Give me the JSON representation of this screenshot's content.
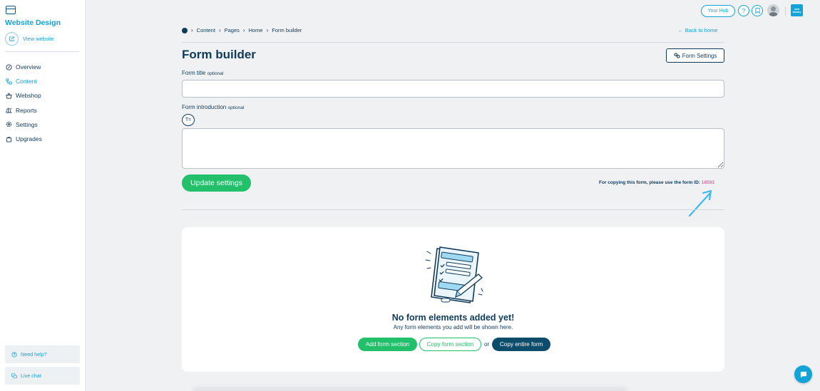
{
  "sidebar": {
    "title": "Website Design",
    "view_website": "View website",
    "items": [
      {
        "label": "Overview",
        "icon": "overview-icon"
      },
      {
        "label": "Content",
        "icon": "content-icon",
        "active": true
      },
      {
        "label": "Webshop",
        "icon": "webshop-icon"
      },
      {
        "label": "Reports",
        "icon": "reports-icon"
      },
      {
        "label": "Settings",
        "icon": "settings-icon"
      },
      {
        "label": "Upgrades",
        "icon": "upgrades-icon"
      }
    ],
    "need_help": "Need help?",
    "live_chat": "Live chat"
  },
  "header": {
    "your_hub": "Your Hub",
    "help_glyph": "?",
    "brand_logo_text": "web factory"
  },
  "breadcrumb": [
    "Content",
    "Pages",
    "Home",
    "Form builder"
  ],
  "back_link": "← Back to home",
  "page_title": "Form builder",
  "form_settings_label": "Form Settings",
  "form_title": {
    "label": "Form title",
    "optional": "optional",
    "value": ""
  },
  "form_intro": {
    "label": "Form introduction",
    "optional": "optional",
    "value": "",
    "format_glyph": "T="
  },
  "update_settings_label": "Update settings",
  "copy_note": {
    "text": "For copying this form, please use the form ID:",
    "form_id": "18593"
  },
  "empty_state": {
    "title": "No form elements added yet!",
    "subtitle": "Any form elements you add will be shown here.",
    "add_section": "Add form section",
    "copy_section": "Copy form section",
    "or": "or",
    "copy_entire": "Copy entire form"
  },
  "colors": {
    "accent": "#12a3d9",
    "navy": "#0e3b5c",
    "green": "#22c06a",
    "form_id": "#d8308b"
  }
}
